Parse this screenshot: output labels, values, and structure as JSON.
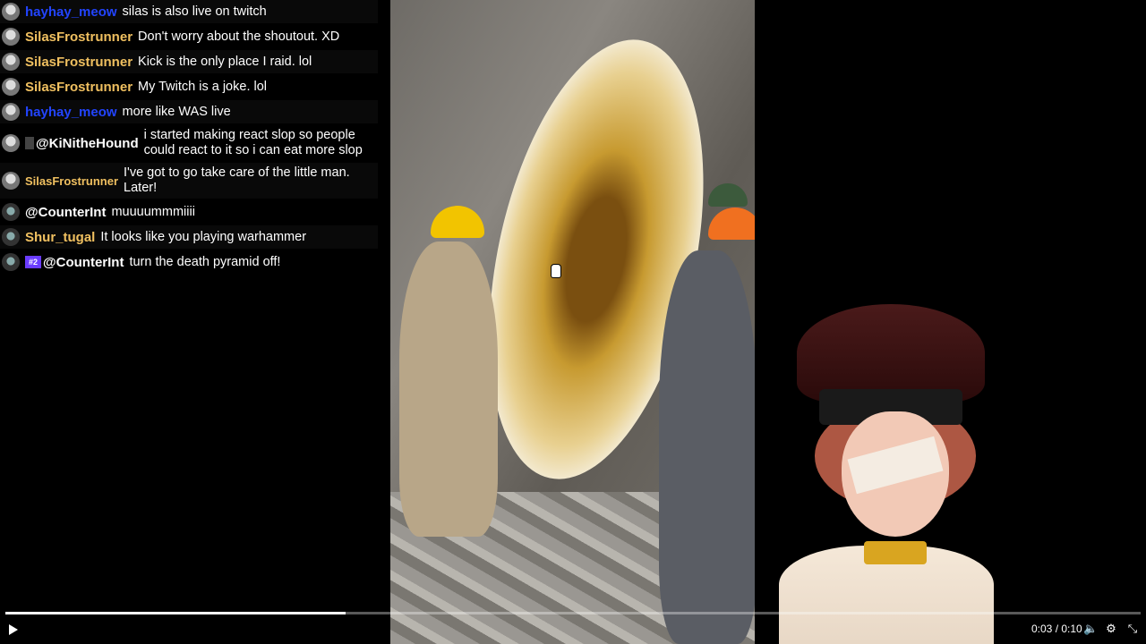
{
  "chat": [
    {
      "user": "hayhay_meow",
      "color": "blue",
      "msg": "silas is also live on twitch",
      "avatar": "light"
    },
    {
      "user": "SilasFrostrunner",
      "color": "gold",
      "msg": "Don't worry about the shoutout. XD",
      "avatar": "light"
    },
    {
      "user": "SilasFrostrunner",
      "color": "gold",
      "msg": "Kick is the only place I raid. lol",
      "avatar": "light"
    },
    {
      "user": "SilasFrostrunner",
      "color": "gold",
      "msg": "My Twitch is a joke. lol",
      "avatar": "light"
    },
    {
      "user": "hayhay_meow",
      "color": "blue",
      "msg": "more like WAS live",
      "avatar": "light"
    },
    {
      "user": "@KiNitheHound",
      "color": "white",
      "msg": "i started making react slop so people could react to it so i can eat more slop",
      "avatar": "light",
      "badge": "small"
    },
    {
      "user": "SilasFrostrunner",
      "color": "gold",
      "msg": "I've got to go take care of the little man. Later!",
      "avatar": "light",
      "small": true
    },
    {
      "user": "@CounterInt",
      "color": "white",
      "msg": "muuuummmiiii",
      "avatar": "dark"
    },
    {
      "user": "Shur_tugal",
      "color": "gold",
      "msg": "It looks like you playing warhammer",
      "avatar": "dark"
    },
    {
      "user": "@CounterInt",
      "color": "white",
      "msg": "turn the death pyramid off!",
      "avatar": "dark",
      "badge": "#2"
    }
  ],
  "player": {
    "time": "0:03 / 0:10",
    "progress_fraction": 0.3,
    "icons": [
      "play-icon",
      "volume-icon",
      "settings-icon",
      "fullscreen-icon"
    ]
  },
  "colors": {
    "blue": "#2244ff",
    "gold": "#f0c060",
    "white": "#ffffff"
  }
}
